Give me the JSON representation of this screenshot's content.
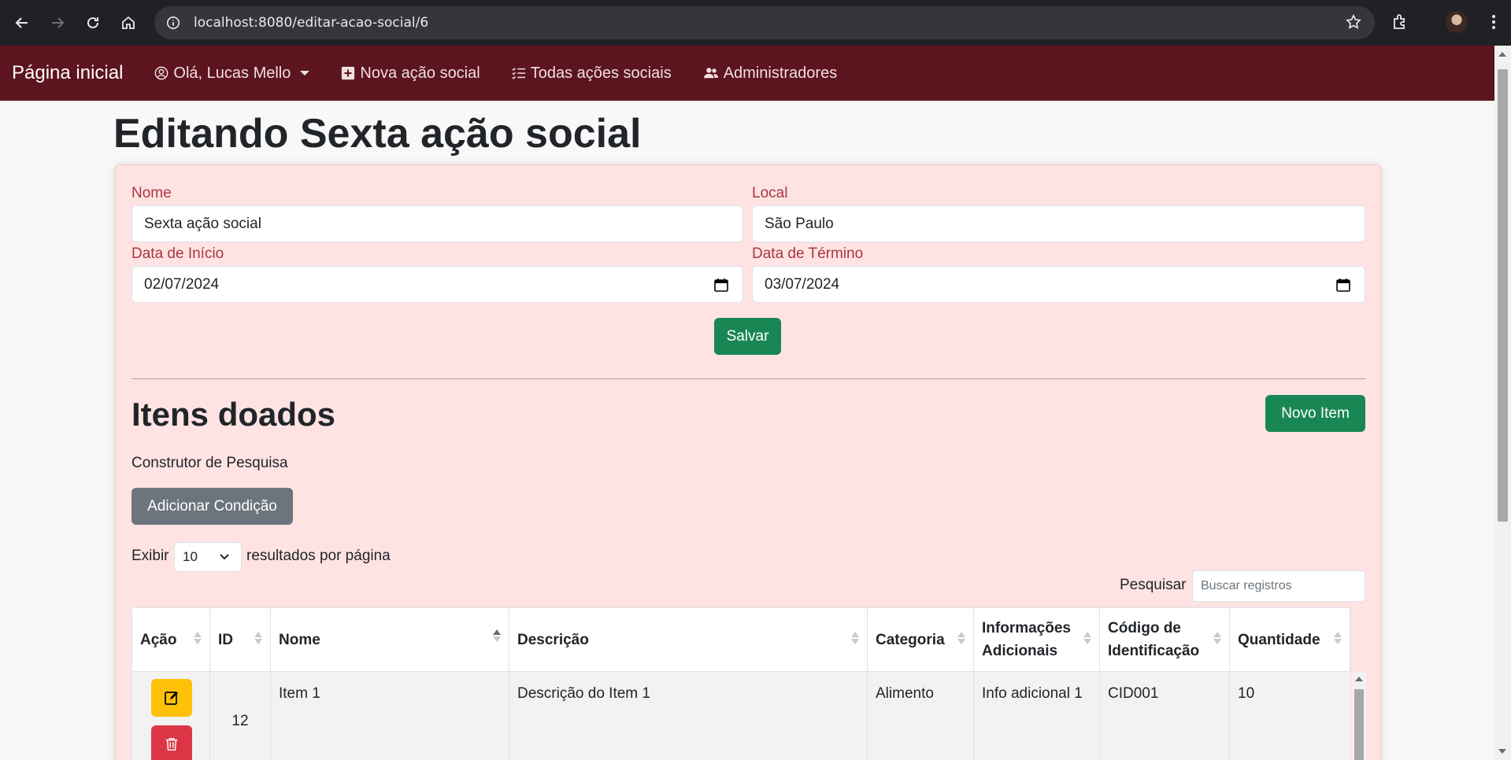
{
  "browser": {
    "url": "localhost:8080/editar-acao-social/6"
  },
  "navbar": {
    "brand": "Página inicial",
    "user": "Olá, Lucas Mello",
    "new_action": "Nova ação social",
    "all_actions": "Todas ações sociais",
    "admins": "Administradores",
    "color": "#5c141e"
  },
  "page": {
    "title": "Editando Sexta ação social"
  },
  "form": {
    "name_label": "Nome",
    "name_value": "Sexta ação social",
    "local_label": "Local",
    "local_value": "São Paulo",
    "start_label": "Data de Início",
    "start_value": "02/07/2024",
    "end_label": "Data de Término",
    "end_value": "03/07/2024",
    "save_label": "Salvar"
  },
  "items": {
    "title": "Itens doados",
    "new_item_label": "Novo Item",
    "search_builder": "Construtor de Pesquisa",
    "add_condition": "Adicionar Condição",
    "show_label": "Exibir",
    "page_size": "10",
    "per_page_label": "resultados por página",
    "search_label": "Pesquisar",
    "search_placeholder": "Buscar registros",
    "columns": [
      "Ação",
      "ID",
      "Nome",
      "Descrição",
      "Categoria",
      "Informações Adicionais",
      "Código de Identificação",
      "Quantidade"
    ],
    "rows": [
      {
        "id": "12",
        "nome": "Item 1",
        "descricao": "Descrição do Item 1",
        "categoria": "Alimento",
        "info": "Info adicional 1",
        "codigo": "CID001",
        "quantidade": "10"
      }
    ]
  }
}
